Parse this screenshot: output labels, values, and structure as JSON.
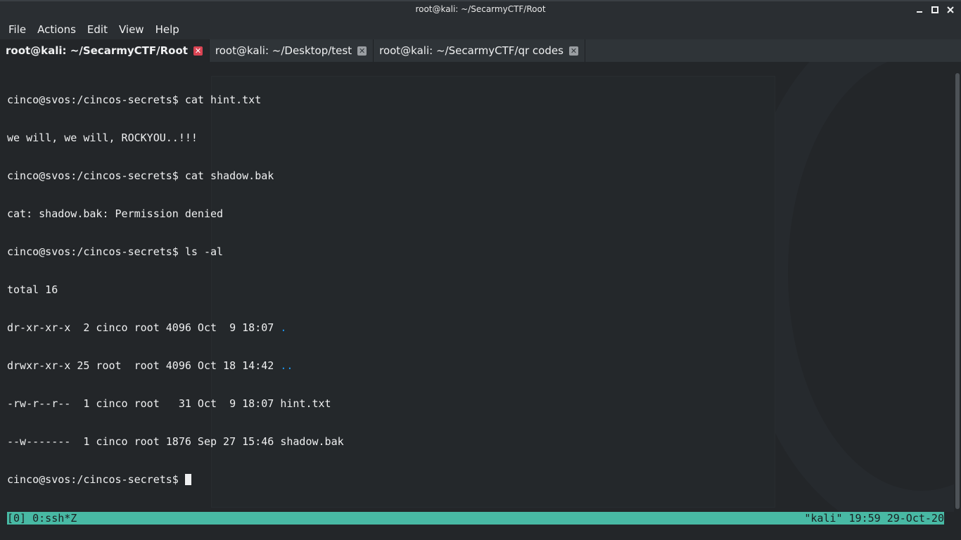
{
  "window": {
    "title": "root@kali: ~/SecarmyCTF/Root"
  },
  "menubar": {
    "items": [
      "File",
      "Actions",
      "Edit",
      "View",
      "Help"
    ]
  },
  "tabs": [
    {
      "label": "root@kali: ~/SecarmyCTF/Root",
      "active": true
    },
    {
      "label": "root@kali: ~/Desktop/test",
      "active": false
    },
    {
      "label": "root@kali: ~/SecarmyCTF/qr codes",
      "active": false
    }
  ],
  "terminal": {
    "lines": [
      {
        "text": "cinco@svos:/cincos-secrets$ cat hint.txt"
      },
      {
        "text": "we will, we will, ROCKYOU..!!!"
      },
      {
        "text": "cinco@svos:/cincos-secrets$ cat shadow.bak"
      },
      {
        "text": "cat: shadow.bak: Permission denied"
      },
      {
        "text": "cinco@svos:/cincos-secrets$ ls -al"
      },
      {
        "text": "total 16"
      },
      {
        "text": "dr-xr-xr-x  2 cinco root 4096 Oct  9 18:07 ",
        "name": "."
      },
      {
        "text": "drwxr-xr-x 25 root  root 4096 Oct 18 14:42 ",
        "name": ".."
      },
      {
        "text": "-rw-r--r--  1 cinco root   31 Oct  9 18:07 hint.txt"
      },
      {
        "text": "--w-------  1 cinco root 1876 Sep 27 15:46 shadow.bak"
      }
    ],
    "prompt": "cinco@svos:/cincos-secrets$ "
  },
  "statusbar": {
    "left": "[0] 0:ssh*Z",
    "right": "\"kali\" 19:59 29-Oct-20"
  },
  "colors": {
    "terminal_bg": "#232629",
    "text": "#eff0f1",
    "directory": "#1d99f3",
    "status_bg": "#48b9a4",
    "tab_close_active": "#da4453"
  },
  "icons": {
    "minimize": "minimize-icon",
    "maximize": "maximize-icon",
    "close": "close-icon",
    "tab_close": "tab-close-icon"
  }
}
